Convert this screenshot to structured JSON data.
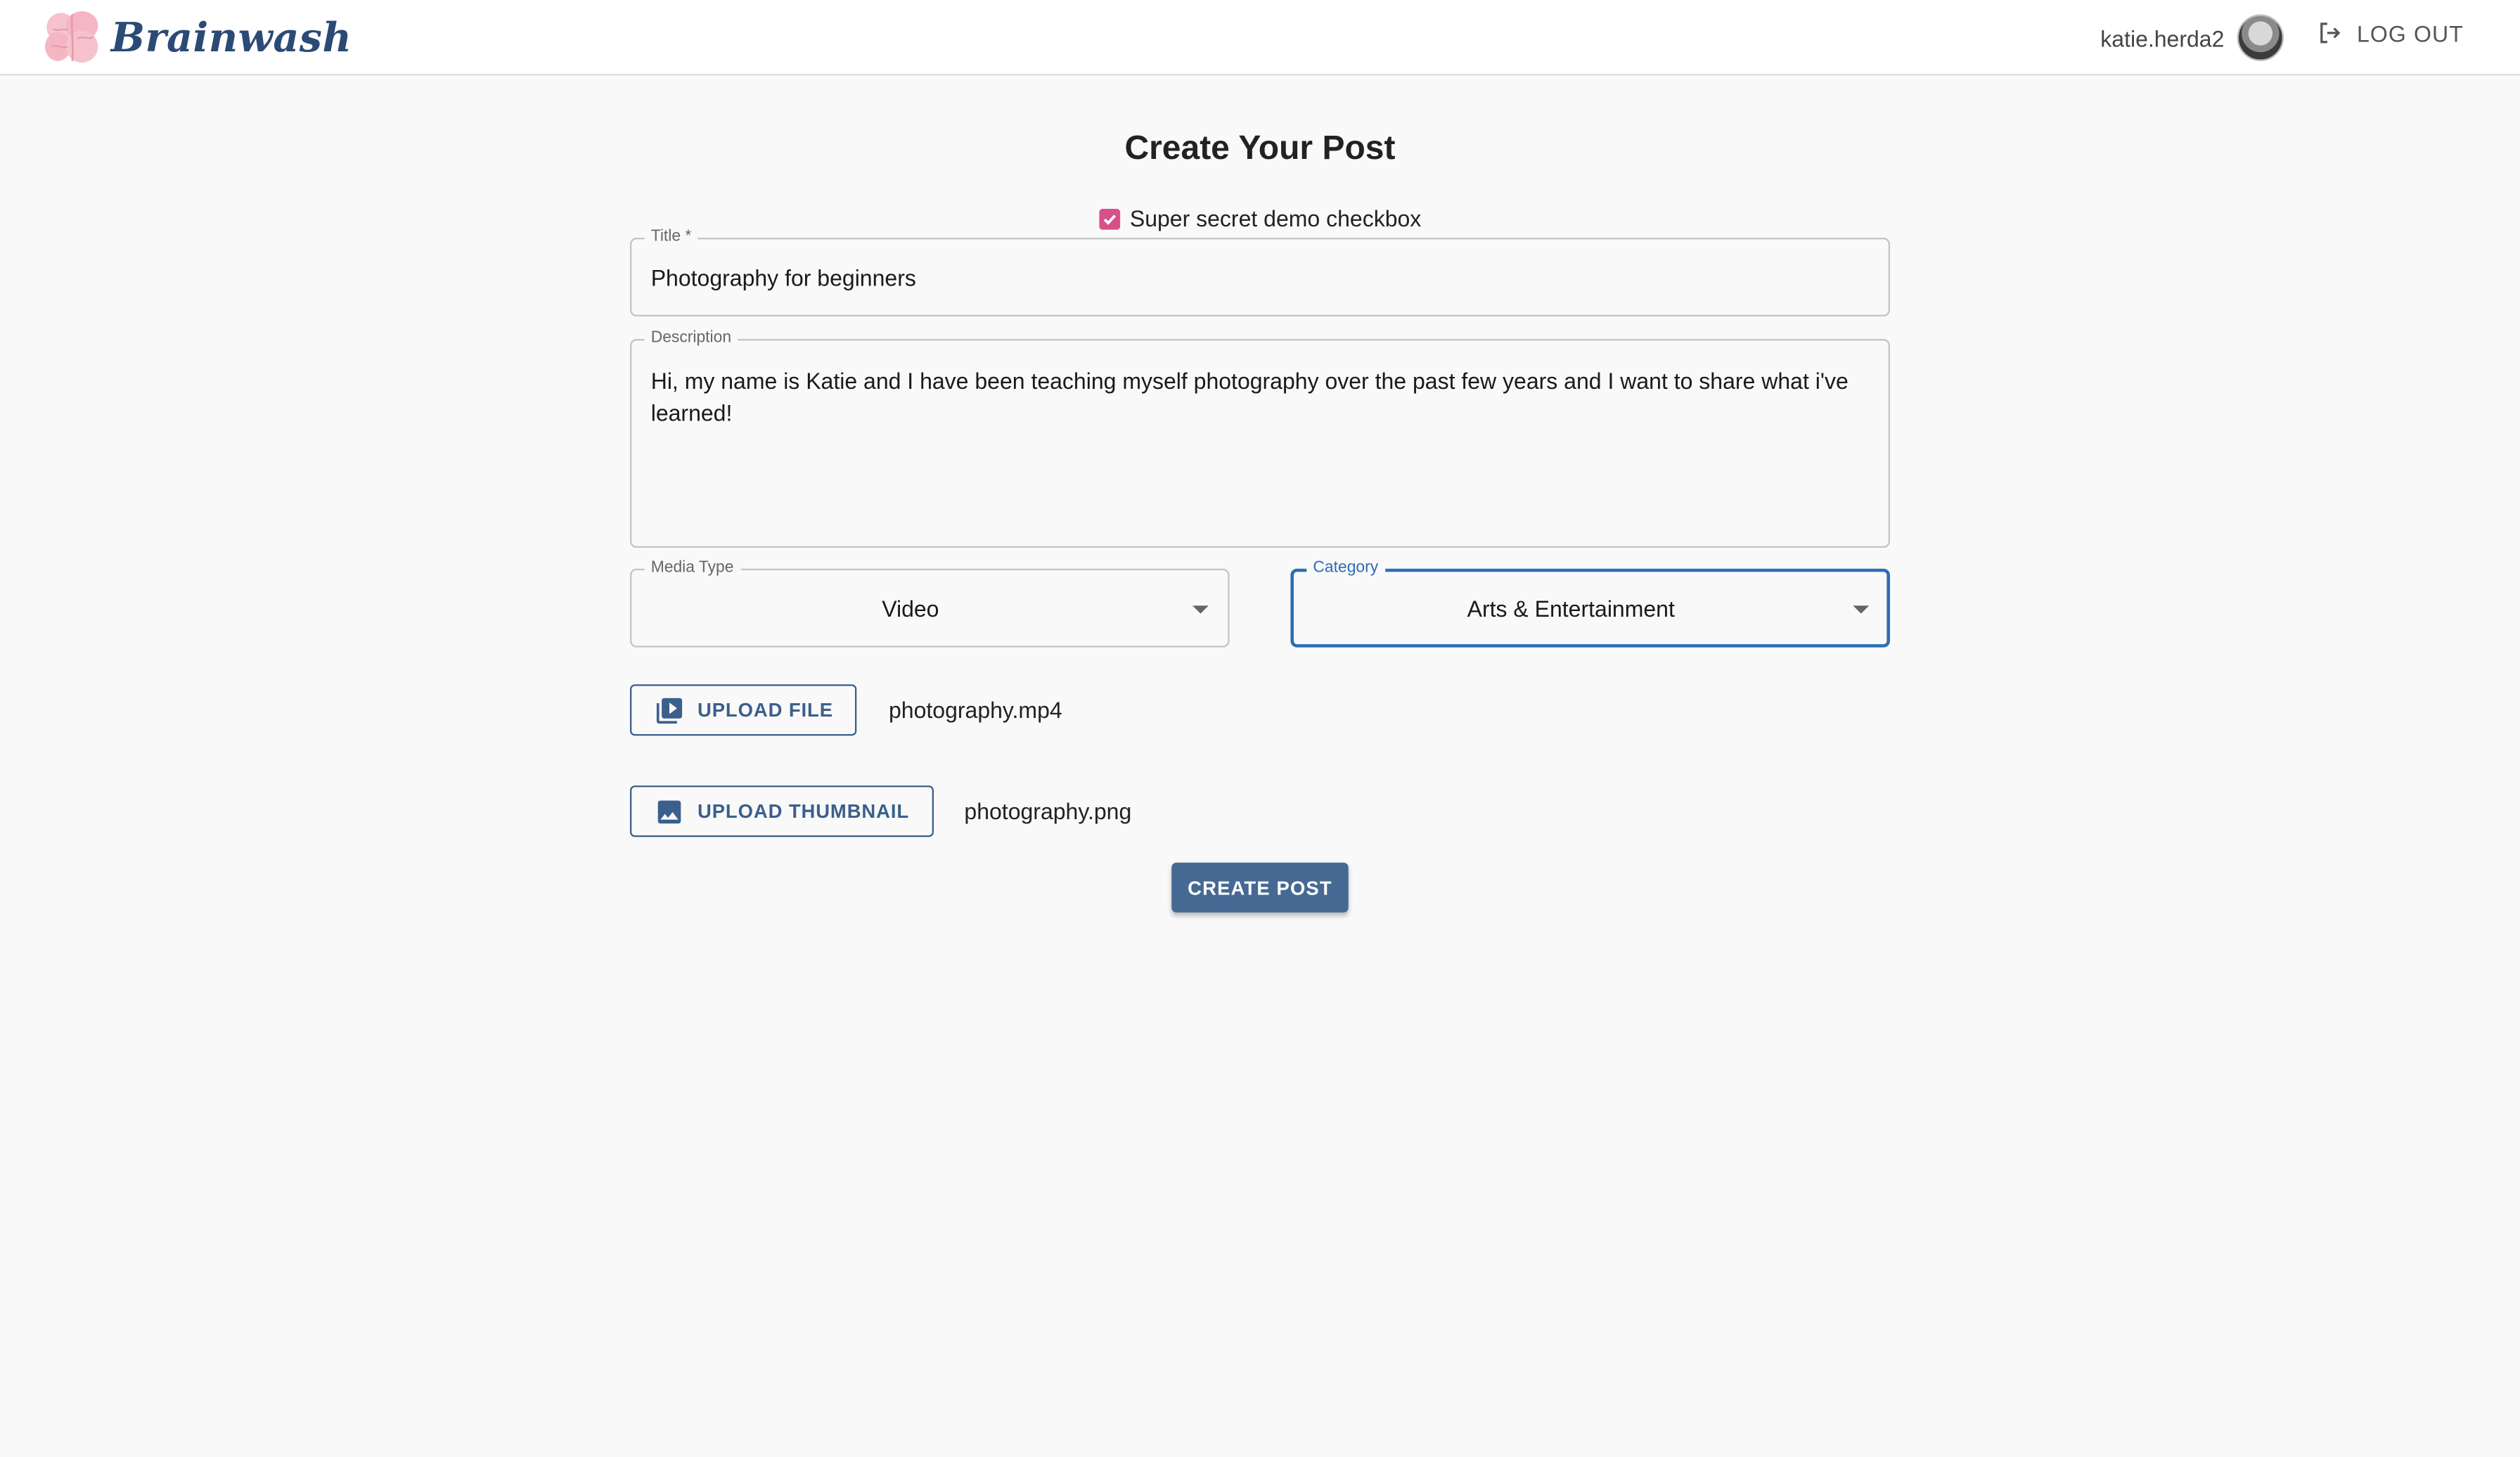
{
  "header": {
    "brand_name": "Brainwash",
    "username": "katie.herda2",
    "logout_label": "LOG OUT"
  },
  "page": {
    "title": "Create Your Post"
  },
  "form": {
    "checkbox_label": "Super secret demo checkbox",
    "checkbox_checked": true,
    "title_label": "Title *",
    "title_value": "Photography for beginners",
    "description_label": "Description",
    "description_value": "Hi, my name is Katie and I have been teaching myself photography over the past few years and I want to share what i've learned!",
    "media_type_label": "Media Type",
    "media_type_value": "Video",
    "category_label": "Category",
    "category_value": "Arts & Entertainment",
    "upload_file_label": "UPLOAD FILE",
    "uploaded_file_name": "photography.mp4",
    "upload_thumbnail_label": "UPLOAD THUMBNAIL",
    "uploaded_thumbnail_name": "photography.png",
    "create_button_label": "CREATE POST"
  },
  "colors": {
    "brand": "#2b4a75",
    "primary": "#456993",
    "checkbox": "#d8508a",
    "focus": "#2f6cb5",
    "background": "#f9f9f9"
  },
  "icons": {
    "logo": "brain-icon",
    "logout": "logout-icon",
    "upload_file": "video-library-icon",
    "upload_thumbnail": "image-icon",
    "checkbox": "check-icon",
    "dropdown": "caret-down-icon"
  }
}
